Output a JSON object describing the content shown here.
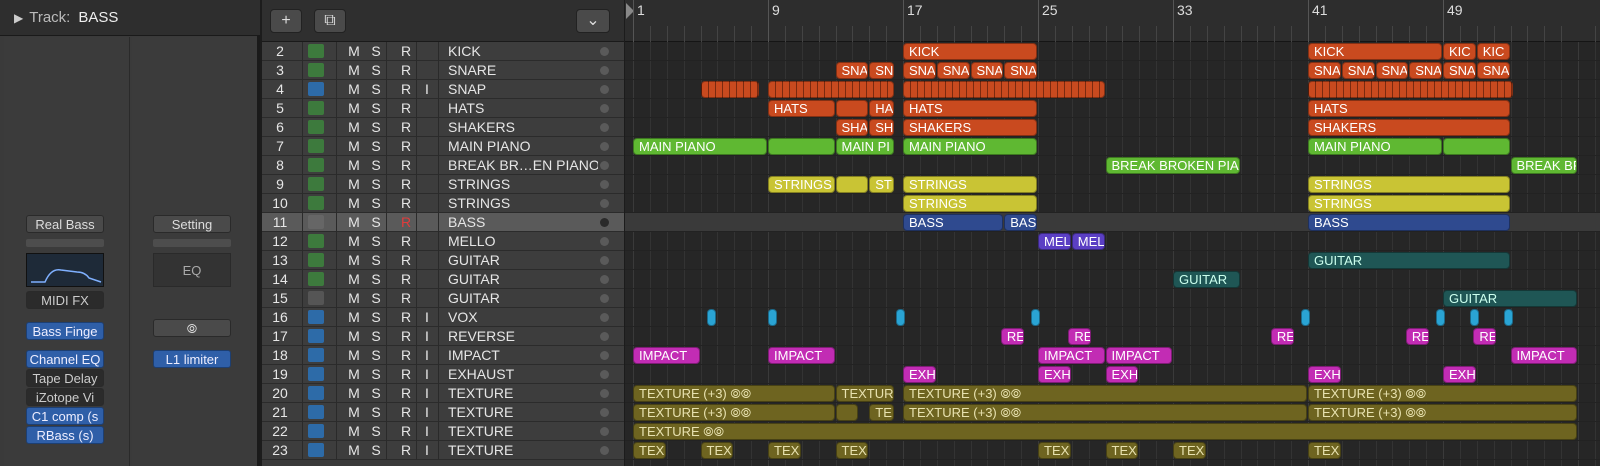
{
  "inspector": {
    "track_label": "Track:",
    "track_name": "BASS",
    "left": {
      "instrument": "Real Bass",
      "midi_fx": "MIDI FX",
      "plugins": [
        "Bass Finge",
        "Channel EQ",
        "Tape Delay",
        "iZotope Vi",
        "C1 comp (s",
        "RBass (s)"
      ]
    },
    "right": {
      "setting": "Setting",
      "eq": "EQ",
      "plugins": [
        "L1 limiter"
      ]
    }
  },
  "toolbar": {
    "add_icon": "+",
    "dup_icon": "⧉",
    "collapse_icon": "⌄"
  },
  "tracks": [
    {
      "num": "2",
      "type": "midi",
      "m": "M",
      "s": "S",
      "r": "R",
      "i": "",
      "name": "KICK"
    },
    {
      "num": "3",
      "type": "midi",
      "m": "M",
      "s": "S",
      "r": "R",
      "i": "",
      "name": "SNARE"
    },
    {
      "num": "4",
      "type": "audio",
      "m": "M",
      "s": "S",
      "r": "R",
      "i": "I",
      "name": "SNAP"
    },
    {
      "num": "5",
      "type": "midi",
      "m": "M",
      "s": "S",
      "r": "R",
      "i": "",
      "name": "HATS"
    },
    {
      "num": "6",
      "type": "midi",
      "m": "M",
      "s": "S",
      "r": "R",
      "i": "",
      "name": "SHAKERS"
    },
    {
      "num": "7",
      "type": "midi",
      "m": "M",
      "s": "S",
      "r": "R",
      "i": "",
      "name": "MAIN PIANO"
    },
    {
      "num": "8",
      "type": "midi",
      "m": "M",
      "s": "S",
      "r": "R",
      "i": "",
      "name": "BREAK BR…EN PIANO"
    },
    {
      "num": "9",
      "type": "midi",
      "m": "M",
      "s": "S",
      "r": "R",
      "i": "",
      "name": "STRINGS"
    },
    {
      "num": "10",
      "type": "midi",
      "m": "M",
      "s": "S",
      "r": "R",
      "i": "",
      "name": "STRINGS"
    },
    {
      "num": "11",
      "type": "amp",
      "m": "M",
      "s": "S",
      "r": "R",
      "i": "",
      "name": "BASS",
      "selected": true
    },
    {
      "num": "12",
      "type": "midi",
      "m": "M",
      "s": "S",
      "r": "R",
      "i": "",
      "name": "MELLO"
    },
    {
      "num": "13",
      "type": "midi",
      "m": "M",
      "s": "S",
      "r": "R",
      "i": "",
      "name": "GUITAR"
    },
    {
      "num": "14",
      "type": "midi",
      "m": "M",
      "s": "S",
      "r": "R",
      "i": "",
      "name": "GUITAR"
    },
    {
      "num": "15",
      "type": "drum",
      "m": "M",
      "s": "S",
      "r": "R",
      "i": "",
      "name": "GUITAR"
    },
    {
      "num": "16",
      "type": "audio",
      "m": "M",
      "s": "S",
      "r": "R",
      "i": "I",
      "name": "VOX"
    },
    {
      "num": "17",
      "type": "audio",
      "m": "M",
      "s": "S",
      "r": "R",
      "i": "I",
      "name": "REVERSE"
    },
    {
      "num": "18",
      "type": "audio",
      "m": "M",
      "s": "S",
      "r": "R",
      "i": "I",
      "name": "IMPACT"
    },
    {
      "num": "19",
      "type": "audio",
      "m": "M",
      "s": "S",
      "r": "R",
      "i": "I",
      "name": "EXHAUST"
    },
    {
      "num": "20",
      "type": "audio",
      "m": "M",
      "s": "S",
      "r": "R",
      "i": "I",
      "name": "TEXTURE"
    },
    {
      "num": "21",
      "type": "audio",
      "m": "M",
      "s": "S",
      "r": "R",
      "i": "I",
      "name": "TEXTURE"
    },
    {
      "num": "22",
      "type": "audio",
      "m": "M",
      "s": "S",
      "r": "R",
      "i": "I",
      "name": "TEXTURE"
    },
    {
      "num": "23",
      "type": "audio",
      "m": "M",
      "s": "S",
      "r": "R",
      "i": "I",
      "name": "TEXTURE"
    }
  ],
  "ruler": {
    "bars": [
      "1",
      "9",
      "17",
      "25",
      "33",
      "41",
      "49"
    ]
  },
  "colors": {
    "orange": "#c94a1f",
    "green": "#5fb832",
    "yellow": "#c9c434",
    "navy": "#2f4a8f",
    "purple": "#5b3fc4",
    "teal": "#1f5655",
    "cyan": "#2aa4d4",
    "magenta": "#c22cb4",
    "olive": "#6e6420"
  },
  "regions": [
    {
      "row": 0,
      "start": 17,
      "len": 8,
      "color": "orange",
      "label": "KICK"
    },
    {
      "row": 0,
      "start": 41,
      "len": 8,
      "color": "orange",
      "label": "KICK"
    },
    {
      "row": 0,
      "start": 49,
      "len": 2,
      "color": "orange",
      "label": "KIC"
    },
    {
      "row": 0,
      "start": 51,
      "len": 2,
      "color": "orange",
      "label": "KIC"
    },
    {
      "row": 1,
      "start": 13,
      "len": 2,
      "color": "orange",
      "label": "SNA"
    },
    {
      "row": 1,
      "start": 15,
      "len": 1.5,
      "color": "orange",
      "label": "SN"
    },
    {
      "row": 1,
      "start": 17,
      "len": 2,
      "color": "orange",
      "label": "SNA"
    },
    {
      "row": 1,
      "start": 19,
      "len": 2,
      "color": "orange",
      "label": "SNA"
    },
    {
      "row": 1,
      "start": 21,
      "len": 2,
      "color": "orange",
      "label": "SNA"
    },
    {
      "row": 1,
      "start": 23,
      "len": 2,
      "color": "orange",
      "label": "SNA"
    },
    {
      "row": 1,
      "start": 41,
      "len": 2,
      "color": "orange",
      "label": "SNA"
    },
    {
      "row": 1,
      "start": 43,
      "len": 2,
      "color": "orange",
      "label": "SNA"
    },
    {
      "row": 1,
      "start": 45,
      "len": 2,
      "color": "orange",
      "label": "SNA"
    },
    {
      "row": 1,
      "start": 47,
      "len": 2,
      "color": "orange",
      "label": "SNA"
    },
    {
      "row": 1,
      "start": 49,
      "len": 2,
      "color": "orange",
      "label": "SNA"
    },
    {
      "row": 1,
      "start": 51,
      "len": 2,
      "color": "orange",
      "label": "SNA"
    },
    {
      "row": 2,
      "start": 5,
      "len": 3.5,
      "color": "orange",
      "label": "",
      "striped": true
    },
    {
      "row": 2,
      "start": 9,
      "len": 7.5,
      "color": "orange",
      "label": "",
      "striped": true
    },
    {
      "row": 2,
      "start": 17,
      "len": 12,
      "color": "orange",
      "label": "",
      "striped": true
    },
    {
      "row": 2,
      "start": 41,
      "len": 12.2,
      "color": "orange",
      "label": "",
      "striped": true
    },
    {
      "row": 3,
      "start": 9,
      "len": 4,
      "color": "orange",
      "label": "HATS"
    },
    {
      "row": 3,
      "start": 13,
      "len": 2,
      "color": "orange",
      "label": ""
    },
    {
      "row": 3,
      "start": 15,
      "len": 1.5,
      "color": "orange",
      "label": "HA"
    },
    {
      "row": 3,
      "start": 17,
      "len": 8,
      "color": "orange",
      "label": "HATS"
    },
    {
      "row": 3,
      "start": 41,
      "len": 12,
      "color": "orange",
      "label": "HATS"
    },
    {
      "row": 4,
      "start": 13,
      "len": 2,
      "color": "orange",
      "label": "SHA"
    },
    {
      "row": 4,
      "start": 15,
      "len": 1.5,
      "color": "orange",
      "label": "SH"
    },
    {
      "row": 4,
      "start": 17,
      "len": 8,
      "color": "orange",
      "label": "SHAKERS"
    },
    {
      "row": 4,
      "start": 41,
      "len": 12,
      "color": "orange",
      "label": "SHAKERS"
    },
    {
      "row": 5,
      "start": 1,
      "len": 8,
      "color": "green",
      "label": "MAIN PIANO"
    },
    {
      "row": 5,
      "start": 9,
      "len": 4,
      "color": "green",
      "label": ""
    },
    {
      "row": 5,
      "start": 13,
      "len": 3.5,
      "color": "green",
      "label": "MAIN PI"
    },
    {
      "row": 5,
      "start": 17,
      "len": 8,
      "color": "green",
      "label": "MAIN PIANO"
    },
    {
      "row": 5,
      "start": 41,
      "len": 8,
      "color": "green",
      "label": "MAIN PIANO"
    },
    {
      "row": 5,
      "start": 49,
      "len": 4,
      "color": "green",
      "label": ""
    },
    {
      "row": 6,
      "start": 29,
      "len": 8,
      "color": "green",
      "label": "BREAK BROKEN PIAN"
    },
    {
      "row": 6,
      "start": 53,
      "len": 4,
      "color": "green",
      "label": "BREAK BR"
    },
    {
      "row": 7,
      "start": 9,
      "len": 4,
      "color": "yellow",
      "label": "STRINGS"
    },
    {
      "row": 7,
      "start": 13,
      "len": 2,
      "color": "yellow",
      "label": ""
    },
    {
      "row": 7,
      "start": 15,
      "len": 1.5,
      "color": "yellow",
      "label": "ST"
    },
    {
      "row": 7,
      "start": 17,
      "len": 8,
      "color": "yellow",
      "label": "STRINGS"
    },
    {
      "row": 7,
      "start": 41,
      "len": 12,
      "color": "yellow",
      "label": "STRINGS"
    },
    {
      "row": 8,
      "start": 17,
      "len": 8,
      "color": "yellow",
      "label": "STRINGS"
    },
    {
      "row": 8,
      "start": 41,
      "len": 12,
      "color": "yellow",
      "label": "STRINGS"
    },
    {
      "row": 9,
      "start": 17,
      "len": 6,
      "color": "navy",
      "label": "BASS"
    },
    {
      "row": 9,
      "start": 23,
      "len": 2,
      "color": "navy",
      "label": "BAS"
    },
    {
      "row": 9,
      "start": 41,
      "len": 12,
      "color": "navy",
      "label": "BASS"
    },
    {
      "row": 10,
      "start": 25,
      "len": 2,
      "color": "purple",
      "label": "MEL"
    },
    {
      "row": 10,
      "start": 27,
      "len": 2,
      "color": "purple",
      "label": "MEL"
    },
    {
      "row": 11,
      "start": 41,
      "len": 12,
      "color": "teal",
      "label": "GUITAR"
    },
    {
      "row": 12,
      "start": 33,
      "len": 4,
      "color": "teal",
      "label": "GUITAR"
    },
    {
      "row": 13,
      "start": 49,
      "len": 8,
      "color": "teal",
      "label": "GUITAR"
    },
    {
      "row": 14,
      "start": 5.4,
      "len": 0.6,
      "color": "cyan",
      "label": ""
    },
    {
      "row": 14,
      "start": 9.0,
      "len": 0.6,
      "color": "cyan",
      "label": ""
    },
    {
      "row": 14,
      "start": 16.6,
      "len": 0.6,
      "color": "cyan",
      "label": ""
    },
    {
      "row": 14,
      "start": 24.6,
      "len": 0.6,
      "color": "cyan",
      "label": ""
    },
    {
      "row": 14,
      "start": 40.6,
      "len": 0.6,
      "color": "cyan",
      "label": ""
    },
    {
      "row": 14,
      "start": 48.6,
      "len": 0.6,
      "color": "cyan",
      "label": ""
    },
    {
      "row": 14,
      "start": 50.6,
      "len": 0.6,
      "color": "cyan",
      "label": ""
    },
    {
      "row": 14,
      "start": 52.6,
      "len": 0.6,
      "color": "cyan",
      "label": ""
    },
    {
      "row": 15,
      "start": 22.8,
      "len": 1.4,
      "color": "magenta",
      "label": "RE"
    },
    {
      "row": 15,
      "start": 26.8,
      "len": 1.4,
      "color": "magenta",
      "label": "RE"
    },
    {
      "row": 15,
      "start": 38.8,
      "len": 1.4,
      "color": "magenta",
      "label": "RE"
    },
    {
      "row": 15,
      "start": 46.8,
      "len": 1.4,
      "color": "magenta",
      "label": "RE"
    },
    {
      "row": 15,
      "start": 50.8,
      "len": 1.4,
      "color": "magenta",
      "label": "RE"
    },
    {
      "row": 16,
      "start": 1,
      "len": 4,
      "color": "magenta",
      "label": "IMPACT"
    },
    {
      "row": 16,
      "start": 9,
      "len": 4,
      "color": "magenta",
      "label": "IMPACT"
    },
    {
      "row": 16,
      "start": 25,
      "len": 4,
      "color": "magenta",
      "label": "IMPACT"
    },
    {
      "row": 16,
      "start": 29,
      "len": 4,
      "color": "magenta",
      "label": "IMPACT"
    },
    {
      "row": 16,
      "start": 53,
      "len": 4,
      "color": "magenta",
      "label": "IMPACT"
    },
    {
      "row": 17,
      "start": 17,
      "len": 2,
      "color": "magenta",
      "label": "EXH"
    },
    {
      "row": 17,
      "start": 25,
      "len": 2,
      "color": "magenta",
      "label": "EXH"
    },
    {
      "row": 17,
      "start": 29,
      "len": 2,
      "color": "magenta",
      "label": "EXH"
    },
    {
      "row": 17,
      "start": 41,
      "len": 2,
      "color": "magenta",
      "label": "EXH"
    },
    {
      "row": 17,
      "start": 49,
      "len": 2,
      "color": "magenta",
      "label": "EXH"
    },
    {
      "row": 18,
      "start": 1,
      "len": 12,
      "color": "olive",
      "label": "TEXTURE (+3)  ⦾⦾"
    },
    {
      "row": 18,
      "start": 13,
      "len": 3.5,
      "color": "olive",
      "label": "TEXTUR"
    },
    {
      "row": 18,
      "start": 17,
      "len": 24,
      "color": "olive",
      "label": "TEXTURE (+3)  ⦾⦾"
    },
    {
      "row": 18,
      "start": 41,
      "len": 16,
      "color": "olive",
      "label": "TEXTURE (+3)  ⦾⦾"
    },
    {
      "row": 19,
      "start": 1,
      "len": 12,
      "color": "olive",
      "label": "TEXTURE (+3)  ⦾⦾"
    },
    {
      "row": 19,
      "start": 13,
      "len": 1.4,
      "color": "olive",
      "label": ""
    },
    {
      "row": 19,
      "start": 15,
      "len": 1.5,
      "color": "olive",
      "label": "TE"
    },
    {
      "row": 19,
      "start": 17,
      "len": 24,
      "color": "olive",
      "label": "TEXTURE (+3)  ⦾⦾"
    },
    {
      "row": 19,
      "start": 41,
      "len": 16,
      "color": "olive",
      "label": "TEXTURE (+3)  ⦾⦾"
    },
    {
      "row": 20,
      "start": 1,
      "len": 56,
      "color": "olive",
      "label": "TEXTURE  ⦾⦾"
    },
    {
      "row": 21,
      "start": 1,
      "len": 2,
      "color": "olive",
      "label": "TEX"
    },
    {
      "row": 21,
      "start": 5,
      "len": 2,
      "color": "olive",
      "label": "TEX"
    },
    {
      "row": 21,
      "start": 9,
      "len": 2,
      "color": "olive",
      "label": "TEX"
    },
    {
      "row": 21,
      "start": 13,
      "len": 2,
      "color": "olive",
      "label": "TEX"
    },
    {
      "row": 21,
      "start": 25,
      "len": 2,
      "color": "olive",
      "label": "TEX"
    },
    {
      "row": 21,
      "start": 29,
      "len": 2,
      "color": "olive",
      "label": "TEX"
    },
    {
      "row": 21,
      "start": 33,
      "len": 2,
      "color": "olive",
      "label": "TEX"
    },
    {
      "row": 21,
      "start": 41,
      "len": 2,
      "color": "olive",
      "label": "TEX"
    }
  ]
}
